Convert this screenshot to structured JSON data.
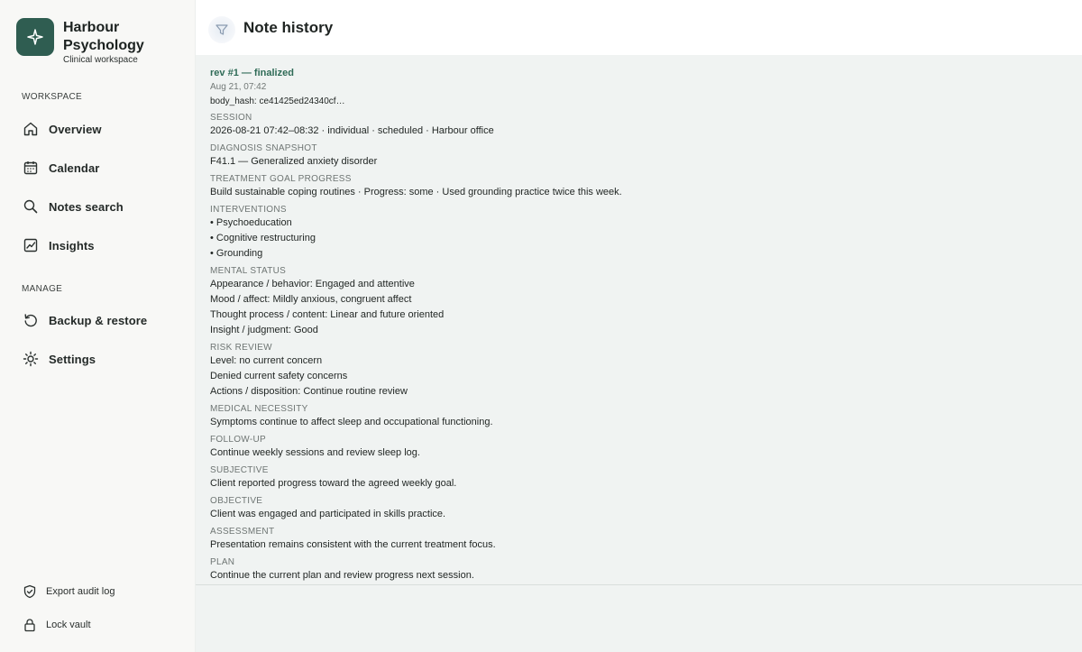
{
  "brand": {
    "name": "Harbour Psychology",
    "subtitle": "Clinical workspace",
    "accent": "#2f5d51"
  },
  "sidebar": {
    "workspace_label": "WORKSPACE",
    "workspace_items": [
      {
        "label": "Overview",
        "icon": "home-icon"
      },
      {
        "label": "Calendar",
        "icon": "calendar-icon"
      },
      {
        "label": "Notes search",
        "icon": "search-icon"
      },
      {
        "label": "Insights",
        "icon": "chart-icon"
      }
    ],
    "manage_label": "MANAGE",
    "manage_items": [
      {
        "label": "Backup & restore",
        "icon": "restore-icon"
      },
      {
        "label": "Settings",
        "icon": "gear-icon"
      }
    ],
    "footer_items": [
      {
        "label": "Export audit log",
        "icon": "shield-icon"
      },
      {
        "label": "Lock vault",
        "icon": "lock-icon"
      }
    ]
  },
  "header": {
    "title": "Note history",
    "icon": "filter-icon"
  },
  "note": {
    "rev_title": "rev #1 — finalized",
    "date": "Aug 21, 07:42",
    "hash": "body_hash: ce41425ed24340cf…",
    "sections": [
      {
        "label": "SESSION",
        "lines": [
          "2026-08-21 07:42–08:32 · individual · scheduled · Harbour office"
        ]
      },
      {
        "label": "DIAGNOSIS SNAPSHOT",
        "lines": [
          "F41.1 — Generalized anxiety disorder"
        ]
      },
      {
        "label": "TREATMENT GOAL PROGRESS",
        "lines": [
          "Build sustainable coping routines · Progress: some · Used grounding practice twice this week."
        ]
      },
      {
        "label": "INTERVENTIONS",
        "bullets": true,
        "lines": [
          "Psychoeducation",
          "Cognitive restructuring",
          "Grounding"
        ]
      },
      {
        "label": "MENTAL STATUS",
        "lines": [
          "Appearance / behavior: Engaged and attentive",
          "Mood / affect: Mildly anxious, congruent affect",
          "Thought process / content: Linear and future oriented",
          "Insight / judgment: Good"
        ]
      },
      {
        "label": "RISK REVIEW",
        "lines": [
          "Level: no current concern",
          "Denied current safety concerns",
          "Actions / disposition: Continue routine review"
        ]
      },
      {
        "label": "MEDICAL NECESSITY",
        "lines": [
          "Symptoms continue to affect sleep and occupational functioning."
        ]
      },
      {
        "label": "FOLLOW-UP",
        "lines": [
          "Continue weekly sessions and review sleep log."
        ]
      },
      {
        "label": "SUBJECTIVE",
        "lines": [
          "Client reported progress toward the agreed weekly goal."
        ]
      },
      {
        "label": "OBJECTIVE",
        "lines": [
          "Client was engaged and participated in skills practice."
        ]
      },
      {
        "label": "ASSESSMENT",
        "lines": [
          "Presentation remains consistent with the current treatment focus."
        ]
      },
      {
        "label": "PLAN",
        "lines": [
          "Continue the current plan and review progress next session."
        ]
      }
    ]
  }
}
